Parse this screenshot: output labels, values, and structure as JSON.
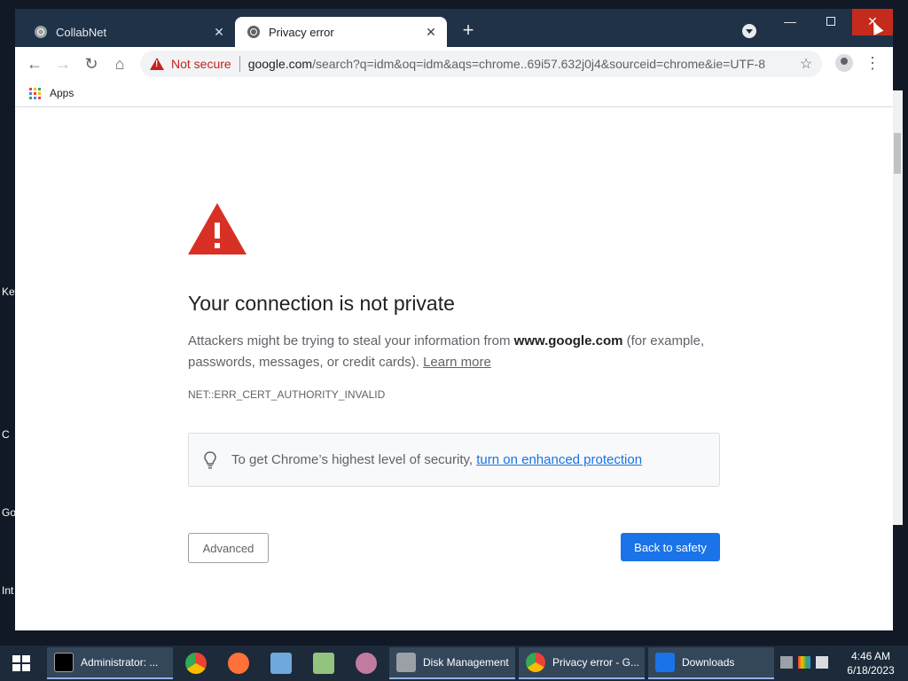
{
  "desktop": {
    "labels": [
      "Key",
      "C",
      "Go",
      "Int"
    ]
  },
  "browser": {
    "tabs": [
      {
        "title": "CollabNet",
        "active": false
      },
      {
        "title": "Privacy error",
        "active": true
      }
    ],
    "new_tab_label": "+",
    "window_controls": {
      "minimize": "—",
      "close": "✕"
    },
    "toolbar": {
      "security_label": "Not secure",
      "url_host": "google.com",
      "url_path": "/search?q=idm&oq=idm&aqs=chrome..69i57.632j0j4&sourceid=chrome&ie=UTF-8"
    },
    "bookmarks": {
      "apps_label": "Apps"
    }
  },
  "page": {
    "headline": "Your connection is not private",
    "desc_before": "Attackers might be trying to steal your information from ",
    "desc_domain": "www.google.com",
    "desc_after": " (for example, passwords, messages, or credit cards). ",
    "learn_more": "Learn more",
    "error_code": "NET::ERR_CERT_AUTHORITY_INVALID",
    "tip_text": "To get Chrome’s highest level of security, ",
    "tip_link": "turn on enhanced protection",
    "advanced_button": "Advanced",
    "back_button": "Back to safety"
  },
  "taskbar": {
    "items": [
      {
        "label": "Administrator: ..."
      },
      {
        "label": "Disk Management"
      },
      {
        "label": "Privacy error - G..."
      },
      {
        "label": "Downloads"
      }
    ],
    "clock_time": "4:46 AM",
    "clock_date": "6/18/2023"
  },
  "colors": {
    "accent": "#1a73e8",
    "warning": "#d93025",
    "not_secure": "#c5221f",
    "close_hover": "#c42b1c"
  }
}
